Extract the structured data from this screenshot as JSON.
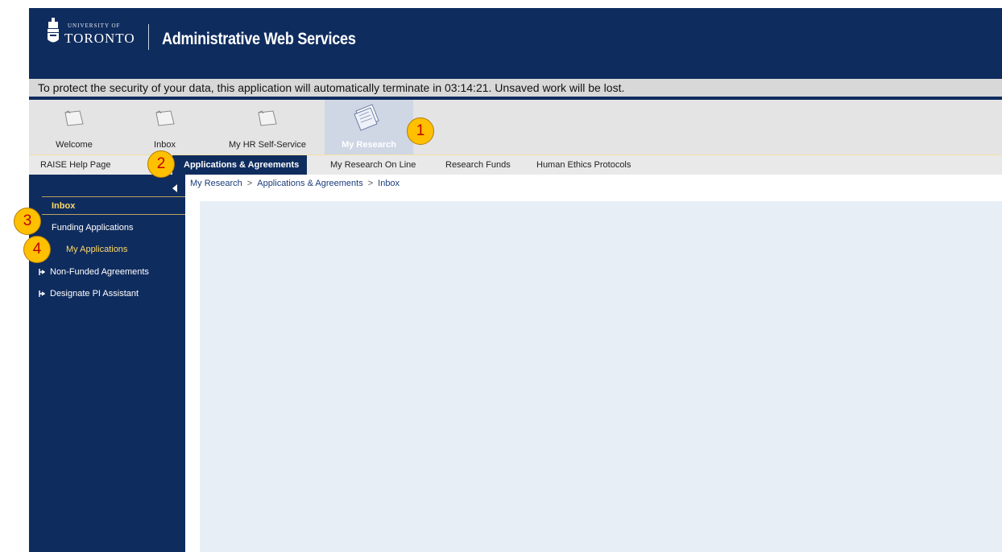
{
  "header": {
    "univ_small": "UNIVERSITY OF",
    "univ_big": "TORONTO",
    "app_title": "Administrative Web Services"
  },
  "security_message": "To protect the security of your data, this application will automatically terminate in 03:14:21. Unsaved work will be lost.",
  "top_tabs": [
    {
      "label": "Welcome",
      "icon": "folder-icon"
    },
    {
      "label": "Inbox",
      "icon": "folder-icon"
    },
    {
      "label": "My HR Self-Service",
      "icon": "folder-icon"
    },
    {
      "label": "My Research",
      "icon": "documents-icon",
      "active": true
    }
  ],
  "sub_tabs": [
    {
      "label": "RAISE Help Page"
    },
    {
      "label": "Applications & Agreements",
      "active": true
    },
    {
      "label": "My Research On Line"
    },
    {
      "label": "Research Funds"
    },
    {
      "label": "Human Ethics Protocols"
    }
  ],
  "breadcrumb": [
    "My Research",
    "Applications & Agreements",
    "Inbox"
  ],
  "sidebar": {
    "items": [
      {
        "label": "Inbox",
        "active": true
      },
      {
        "label": "Funding Applications"
      },
      {
        "label": "My Applications"
      },
      {
        "label": "Non-Funded Agreements"
      },
      {
        "label": "Designate PI Assistant"
      }
    ]
  },
  "callouts": [
    "1",
    "2",
    "3",
    "4"
  ],
  "colors": {
    "navy": "#0f2c5e",
    "gold": "#ffc000",
    "callout_text": "#c00000",
    "highlight_text": "#ffd966"
  }
}
